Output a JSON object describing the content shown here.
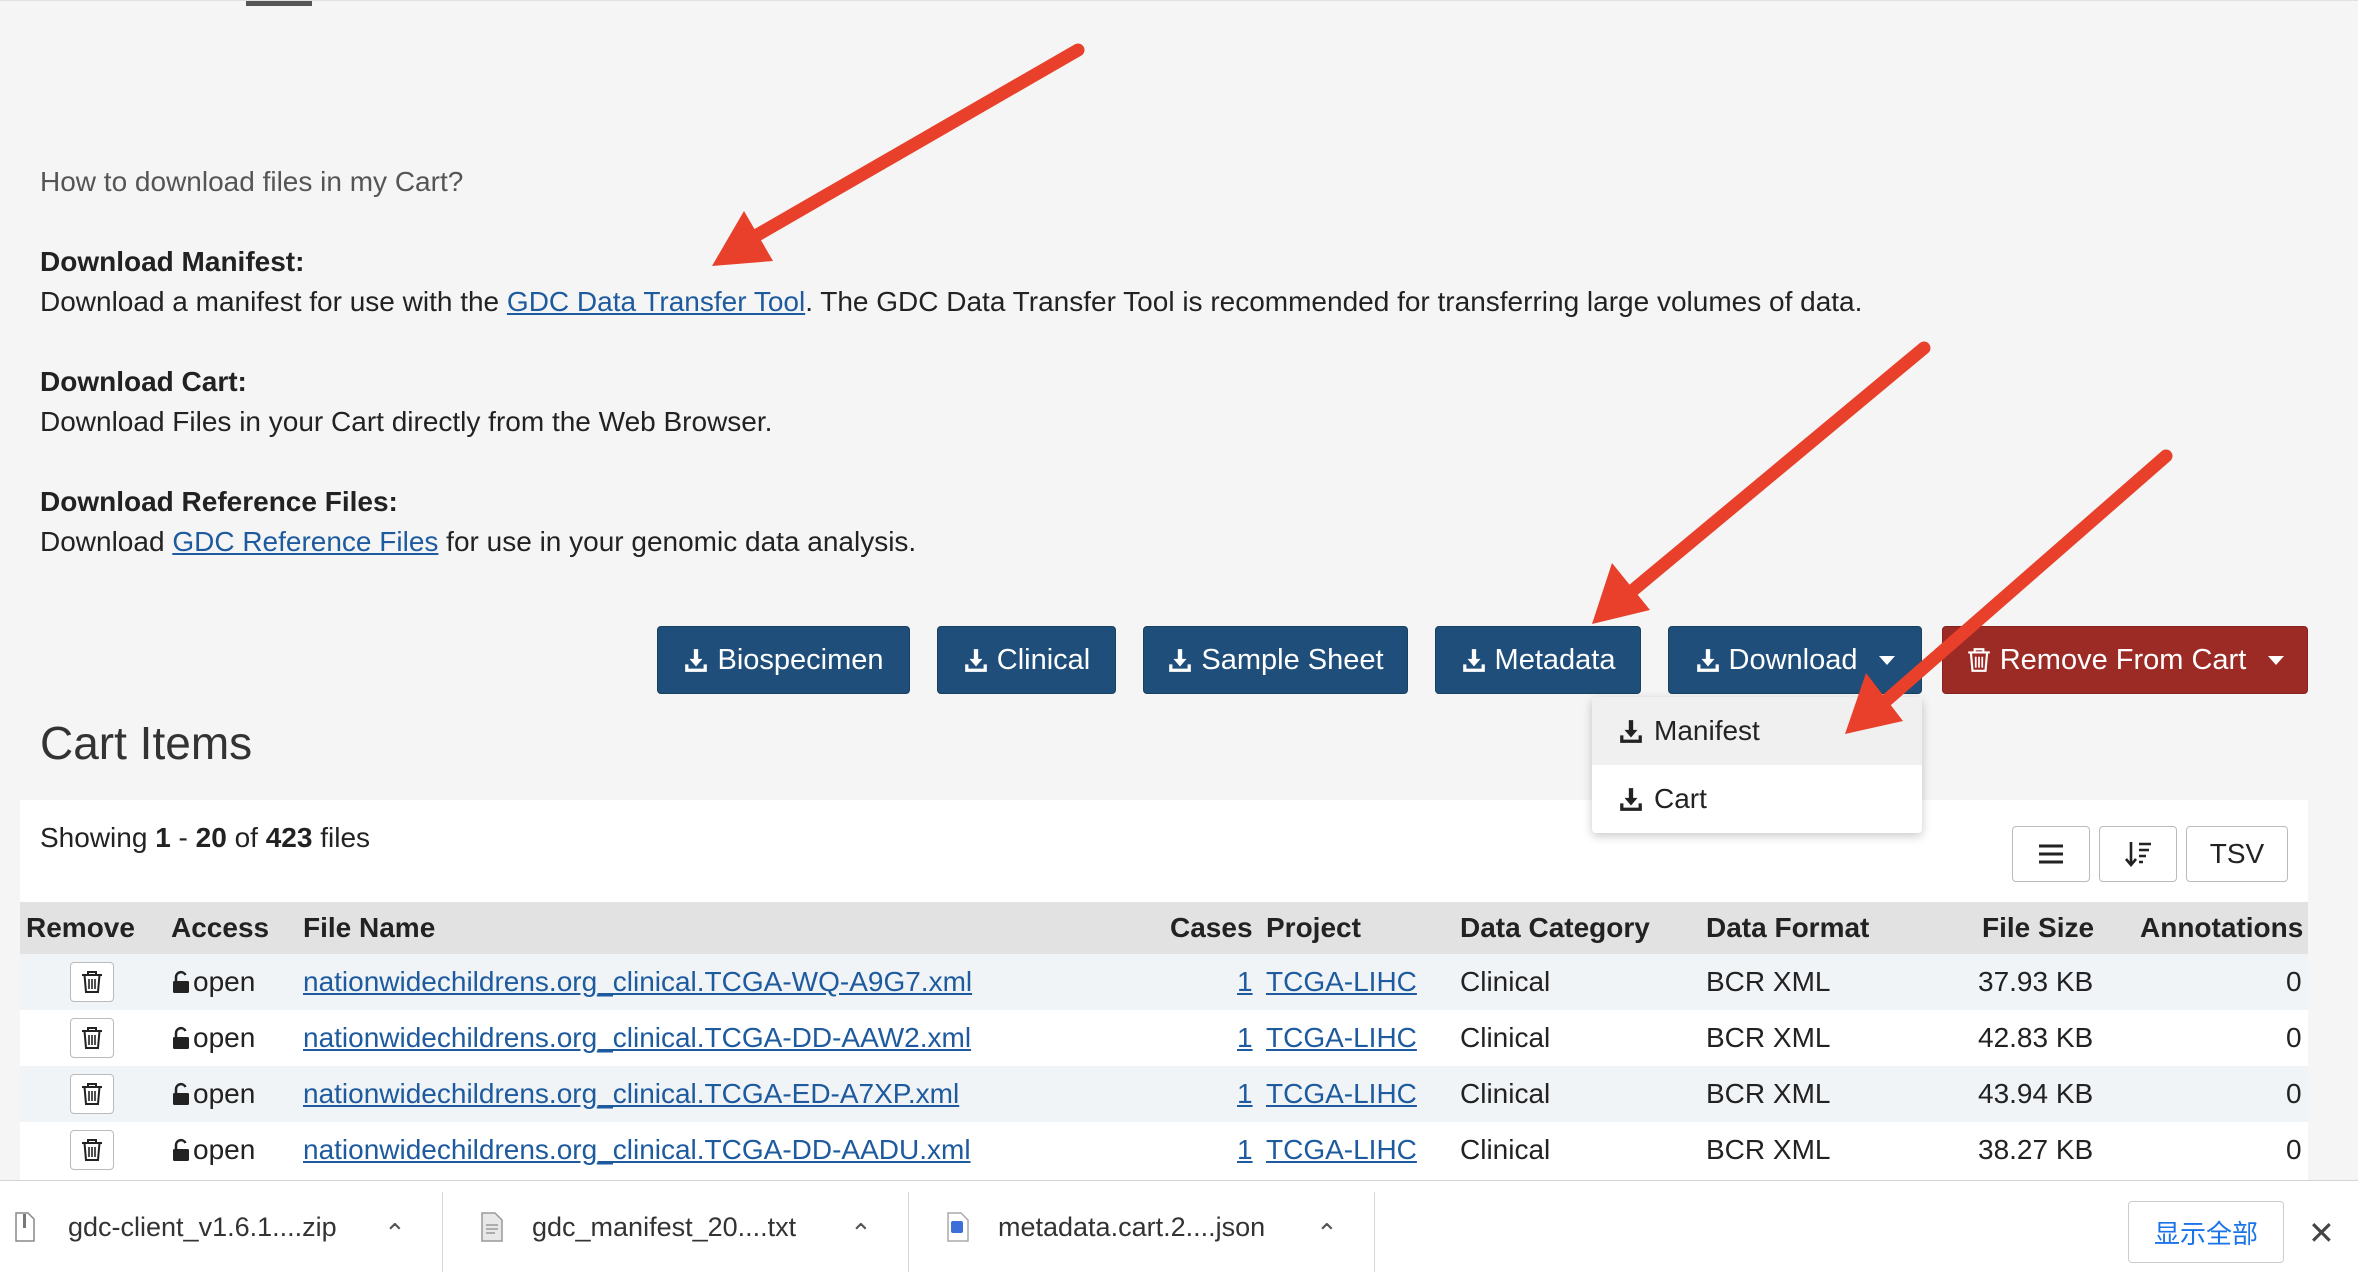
{
  "help": {
    "question": "How to download files in my Cart?",
    "manifest_title": "Download Manifest:",
    "manifest_pre": "Download a manifest for use with the ",
    "manifest_link": "GDC Data Transfer Tool",
    "manifest_post": ". The GDC Data Transfer Tool is recommended for transferring large volumes of data.",
    "cart_title": "Download Cart:",
    "cart_text": "Download Files in your Cart directly from the Web Browser.",
    "ref_title": "Download Reference Files:",
    "ref_pre": "Download ",
    "ref_link": "GDC Reference Files",
    "ref_post": " for use in your genomic data analysis."
  },
  "toolbar": {
    "biospecimen": "Biospecimen",
    "clinical": "Clinical",
    "sample_sheet": "Sample Sheet",
    "metadata": "Metadata",
    "download": "Download",
    "remove_from_cart": "Remove From Cart"
  },
  "download_menu": {
    "manifest": "Manifest",
    "cart": "Cart"
  },
  "cart": {
    "title": "Cart Items",
    "showing_label": "Showing",
    "range_start": "1",
    "range_sep": "-",
    "range_end": "20",
    "of_label": "of",
    "total": "423",
    "files_label": "files",
    "tsv_label": "TSV"
  },
  "table": {
    "headers": {
      "remove": "Remove",
      "access": "Access",
      "file_name": "File Name",
      "cases": "Cases",
      "project": "Project",
      "data_category": "Data Category",
      "data_format": "Data Format",
      "file_size": "File Size",
      "annotations": "Annotations"
    },
    "rows": [
      {
        "access": "open",
        "file_name": "nationwidechildrens.org_clinical.TCGA-WQ-A9G7.xml",
        "cases": "1",
        "project": "TCGA-LIHC",
        "data_category": "Clinical",
        "data_format": "BCR XML",
        "file_size": "37.93 KB",
        "annotations": "0"
      },
      {
        "access": "open",
        "file_name": "nationwidechildrens.org_clinical.TCGA-DD-AAW2.xml",
        "cases": "1",
        "project": "TCGA-LIHC",
        "data_category": "Clinical",
        "data_format": "BCR XML",
        "file_size": "42.83 KB",
        "annotations": "0"
      },
      {
        "access": "open",
        "file_name": "nationwidechildrens.org_clinical.TCGA-ED-A7XP.xml",
        "cases": "1",
        "project": "TCGA-LIHC",
        "data_category": "Clinical",
        "data_format": "BCR XML",
        "file_size": "43.94 KB",
        "annotations": "0"
      },
      {
        "access": "open",
        "file_name": "nationwidechildrens.org_clinical.TCGA-DD-AADU.xml",
        "cases": "1",
        "project": "TCGA-LIHC",
        "data_category": "Clinical",
        "data_format": "BCR XML",
        "file_size": "38.27 KB",
        "annotations": "0"
      }
    ]
  },
  "downloads_bar": {
    "items": [
      {
        "name": "gdc-client_v1.6.1....zip",
        "icon": "zip-file-icon"
      },
      {
        "name": "gdc_manifest_20....txt",
        "icon": "text-file-icon"
      },
      {
        "name": "metadata.cart.2....json",
        "icon": "json-file-icon"
      }
    ],
    "show_all": "显示全部",
    "close": "✕"
  },
  "colors": {
    "primary_button": "#1f4e7a",
    "danger_button": "#9c2a25",
    "link": "#1d5a9e",
    "annotation_arrow": "#e8402a"
  }
}
